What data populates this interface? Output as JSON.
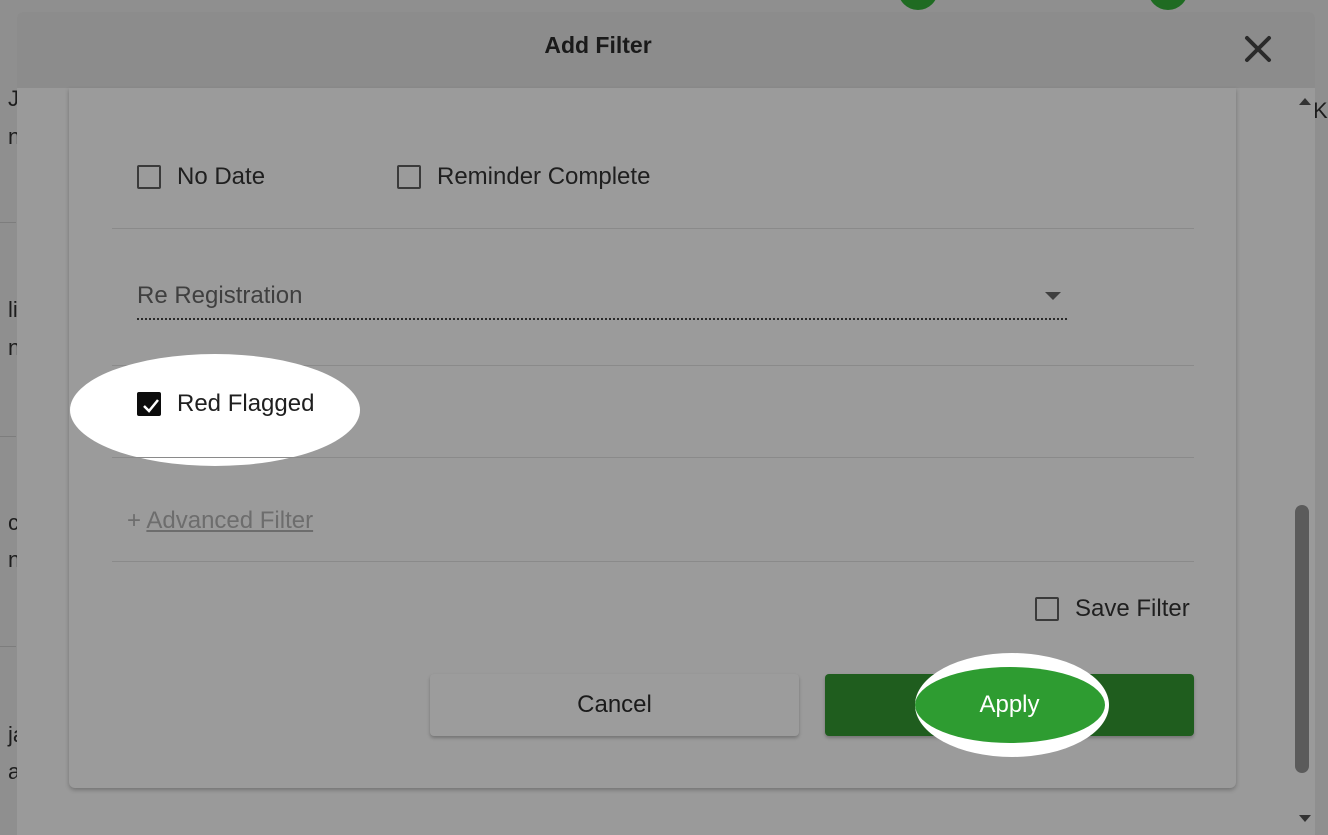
{
  "background": {
    "left_text_fragments": [
      "J",
      "n",
      "li",
      "n",
      "c",
      "n",
      "ja",
      "a"
    ],
    "right_text_fragment": "KI"
  },
  "modal": {
    "title": "Add Filter",
    "close_icon": "close-icon",
    "checkboxes_row": [
      {
        "label": "No Date",
        "checked": false
      },
      {
        "label": "Reminder Complete",
        "checked": false
      }
    ],
    "dropdown": {
      "value": "Re Registration",
      "icon": "chevron-down-icon"
    },
    "red_flagged": {
      "label": "Red Flagged",
      "checked": true
    },
    "advanced_filter": {
      "prefix": "+",
      "label": "Advanced Filter"
    },
    "save_filter": {
      "label": "Save Filter",
      "checked": false
    },
    "buttons": {
      "cancel": "Cancel",
      "apply": "Apply"
    }
  },
  "colors": {
    "apply_button": "#1f5d1e",
    "apply_highlight": "#2e9c31",
    "overlay": "#8f8f8f"
  }
}
